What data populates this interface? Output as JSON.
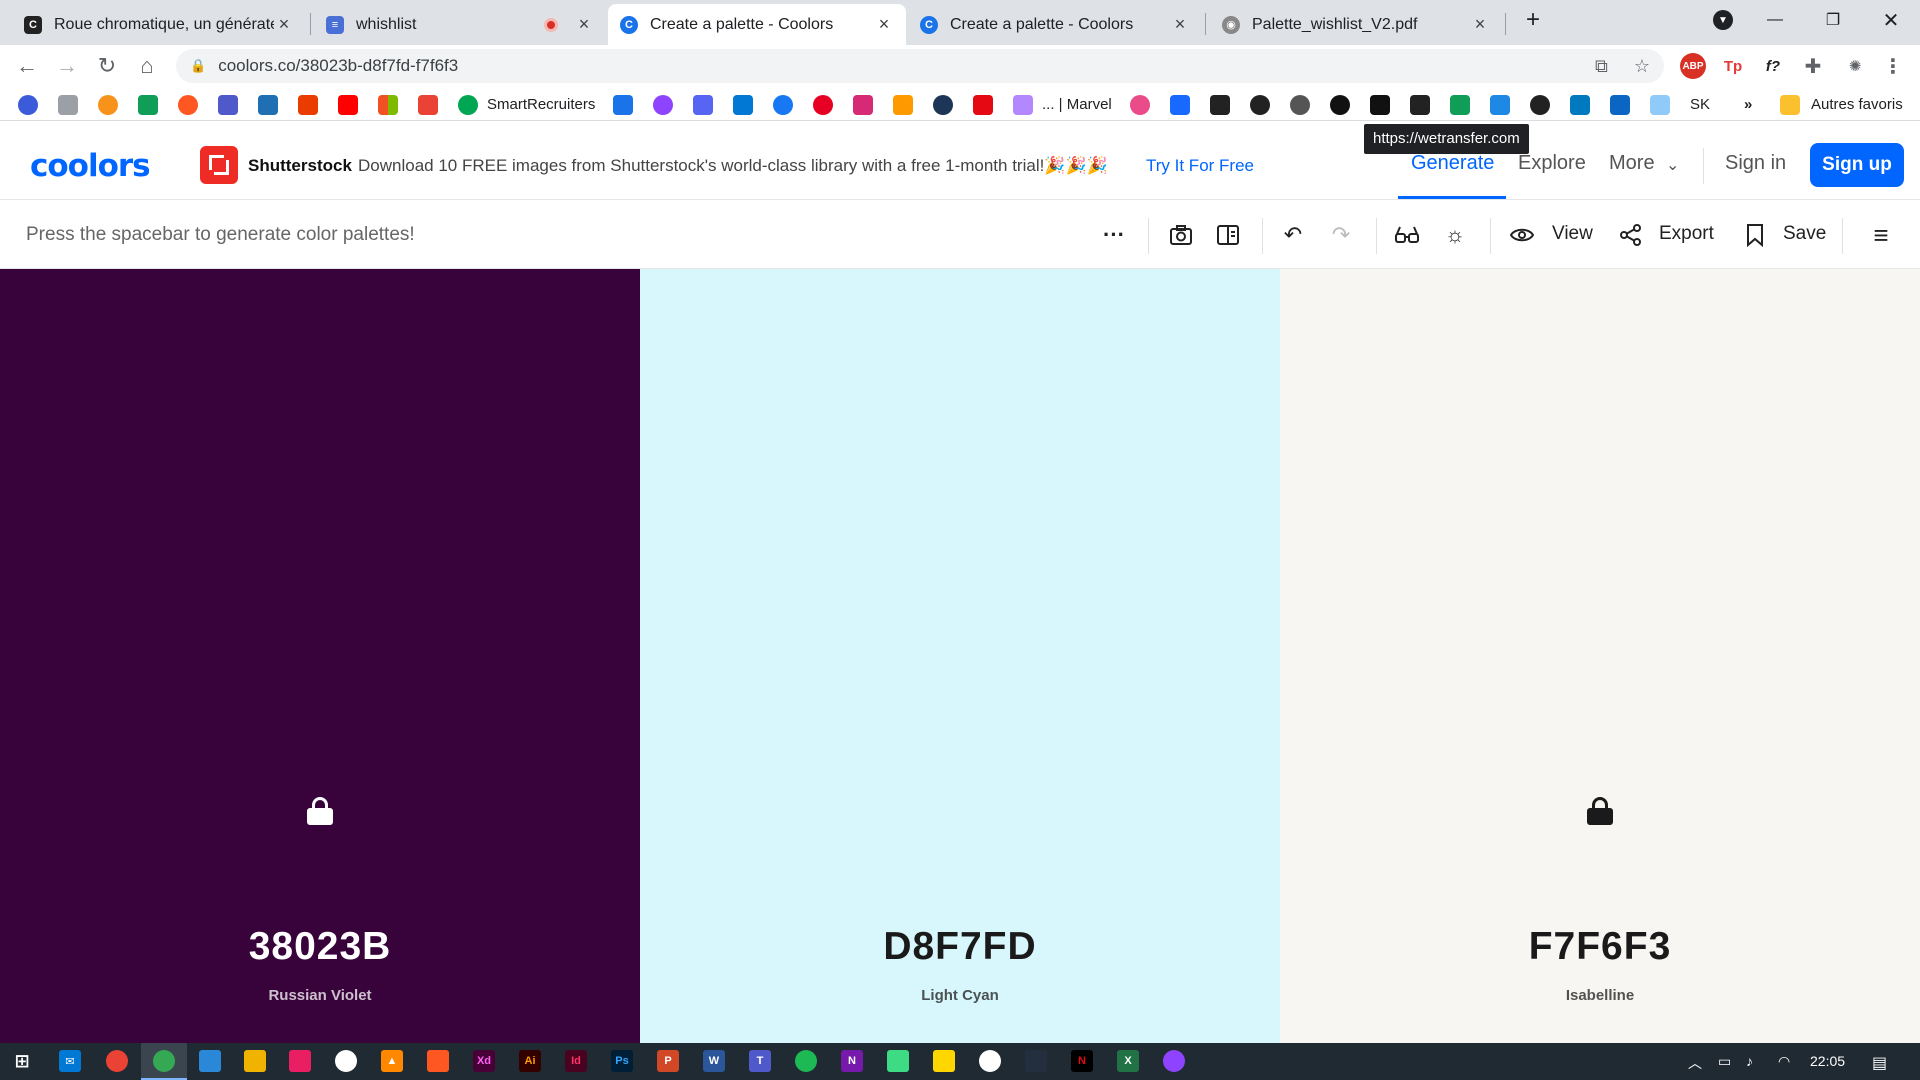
{
  "browser": {
    "tabs": [
      {
        "title": "Roue chromatique, un générateur",
        "icon": "coolors-icon",
        "active": false
      },
      {
        "title": "whishlist",
        "icon": "doc-icon",
        "active": false,
        "recording": true
      },
      {
        "title": "Create a palette - Coolors",
        "icon": "coolors-c-icon",
        "active": true
      },
      {
        "title": "Create a palette - Coolors",
        "icon": "coolors-c-icon",
        "active": false
      },
      {
        "title": "Palette_wishlist_V2.pdf",
        "icon": "globe-icon",
        "active": false
      }
    ],
    "new_tab": "+",
    "url": "coolors.co/38023b-d8f7fd-f7f6f3",
    "bookmarks": {
      "smartrecruiters": "SmartRecruiters",
      "marvel": "... | Marvel",
      "sk": "SK",
      "more": "»",
      "other": "Autres favoris"
    },
    "tooltip": "https://wetransfer.com"
  },
  "site": {
    "logo": "coolors",
    "promo": {
      "brand": "Shutterstock",
      "text": "Download 10 FREE images from Shutterstock's world-class library with a free 1-month trial!🎉🎉🎉",
      "cta": "Try It For Free"
    },
    "nav": {
      "generate": "Generate",
      "explore": "Explore",
      "more": "More",
      "sign_in": "Sign in",
      "sign_up": "Sign up"
    },
    "toolbar": {
      "hint": "Press the spacebar to generate color palettes!",
      "view": "View",
      "export": "Export",
      "save": "Save"
    },
    "palette": [
      {
        "hex": "38023B",
        "name": "Russian Violet",
        "bg": "#38023b",
        "fg": "#ffffff",
        "locked": true
      },
      {
        "hex": "D8F7FD",
        "name": "Light Cyan",
        "bg": "#d8f7fd",
        "fg": "#1a1a1a",
        "locked": false
      },
      {
        "hex": "F7F6F3",
        "name": "Isabelline",
        "bg": "#f7f6f3",
        "fg": "#1a1a1a",
        "locked": true
      }
    ]
  },
  "taskbar": {
    "time": "22:05"
  },
  "colors": {
    "accent": "#0066ff",
    "tab_strip": "#dee1e6",
    "taskbar": "#1f2a33"
  }
}
